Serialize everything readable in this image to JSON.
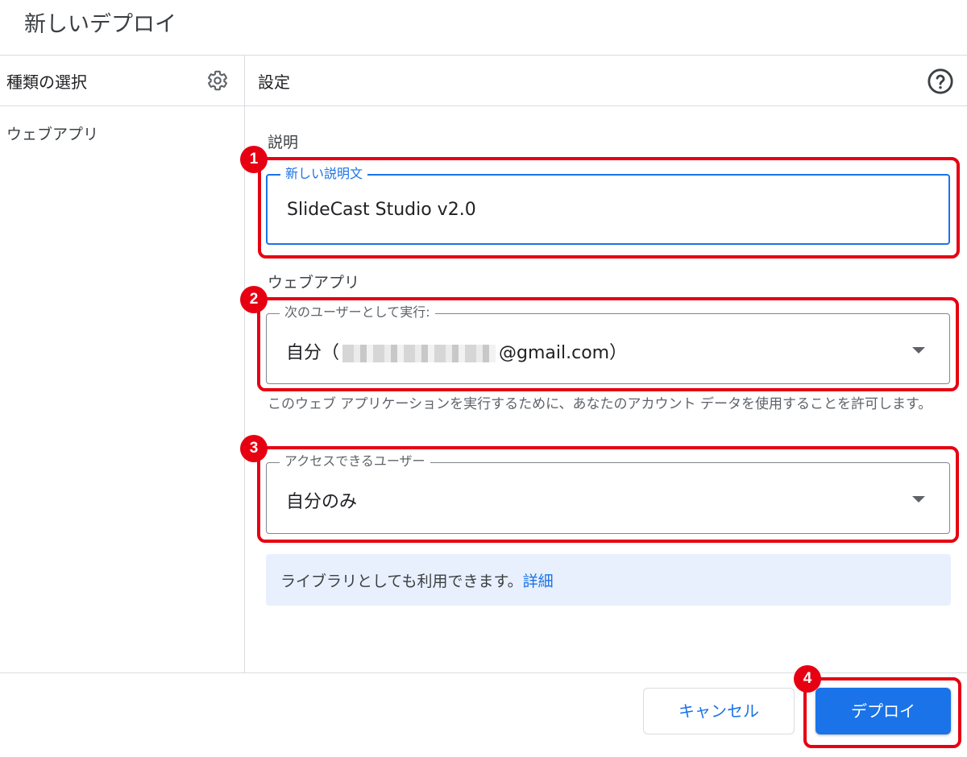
{
  "dialog": {
    "title": "新しいデプロイ"
  },
  "left_panel": {
    "header": "種類の選択",
    "items": [
      {
        "label": "ウェブアプリ"
      }
    ]
  },
  "settings": {
    "header": "設定",
    "description_section": "説明",
    "description_field": {
      "label": "新しい説明文",
      "value": "SlideCast Studio v2.0"
    },
    "webapp_section": "ウェブアプリ",
    "execute_as": {
      "label": "次のユーザーとして実行:",
      "value_prefix": "自分（",
      "value_suffix": "@gmail.com）"
    },
    "execute_help": "このウェブ アプリケーションを実行するために、あなたのアカウント データを使用することを許可します。",
    "access": {
      "label": "アクセスできるユーザー",
      "value": "自分のみ"
    },
    "info": {
      "text": "ライブラリとしても利用できます。",
      "link": "詳細"
    }
  },
  "footer": {
    "cancel_label": "キャンセル",
    "deploy_label": "デプロイ"
  },
  "annotations": [
    "1",
    "2",
    "3",
    "4"
  ],
  "colors": {
    "accent": "#1a73e8",
    "highlight": "#e60012",
    "info_bg": "#e8f0fe"
  }
}
